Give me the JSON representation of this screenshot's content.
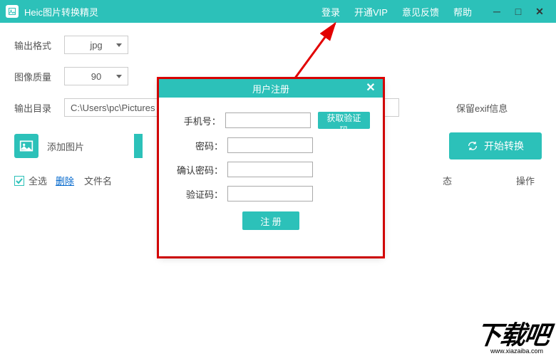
{
  "titlebar": {
    "app_name": "Heic图片转换精灵",
    "links": {
      "login": "登录",
      "vip": "开通VIP",
      "feedback": "意见反馈",
      "help": "帮助"
    }
  },
  "settings": {
    "output_format_label": "输出格式",
    "output_format_value": "jpg",
    "image_quality_label": "图像质量",
    "image_quality_value": "90",
    "output_dir_label": "输出目录",
    "output_dir_value": "C:\\Users\\pc\\Pictures",
    "keep_exif_label": "保留exif信息"
  },
  "actions": {
    "add_image_label": "添加图片",
    "start_convert_label": "开始转换"
  },
  "list": {
    "select_all": "全选",
    "delete": "删除",
    "filename": "文件名",
    "status": "态",
    "operation": "操作"
  },
  "modal": {
    "title": "用户注册",
    "phone_label": "手机号：",
    "password_label": "密码：",
    "confirm_password_label": "确认密码：",
    "code_label": "验证码：",
    "get_code_btn": "获取验证码",
    "register_btn": "注 册"
  },
  "watermark": {
    "main": "下载吧",
    "sub": "www.xiazaiba.com"
  }
}
